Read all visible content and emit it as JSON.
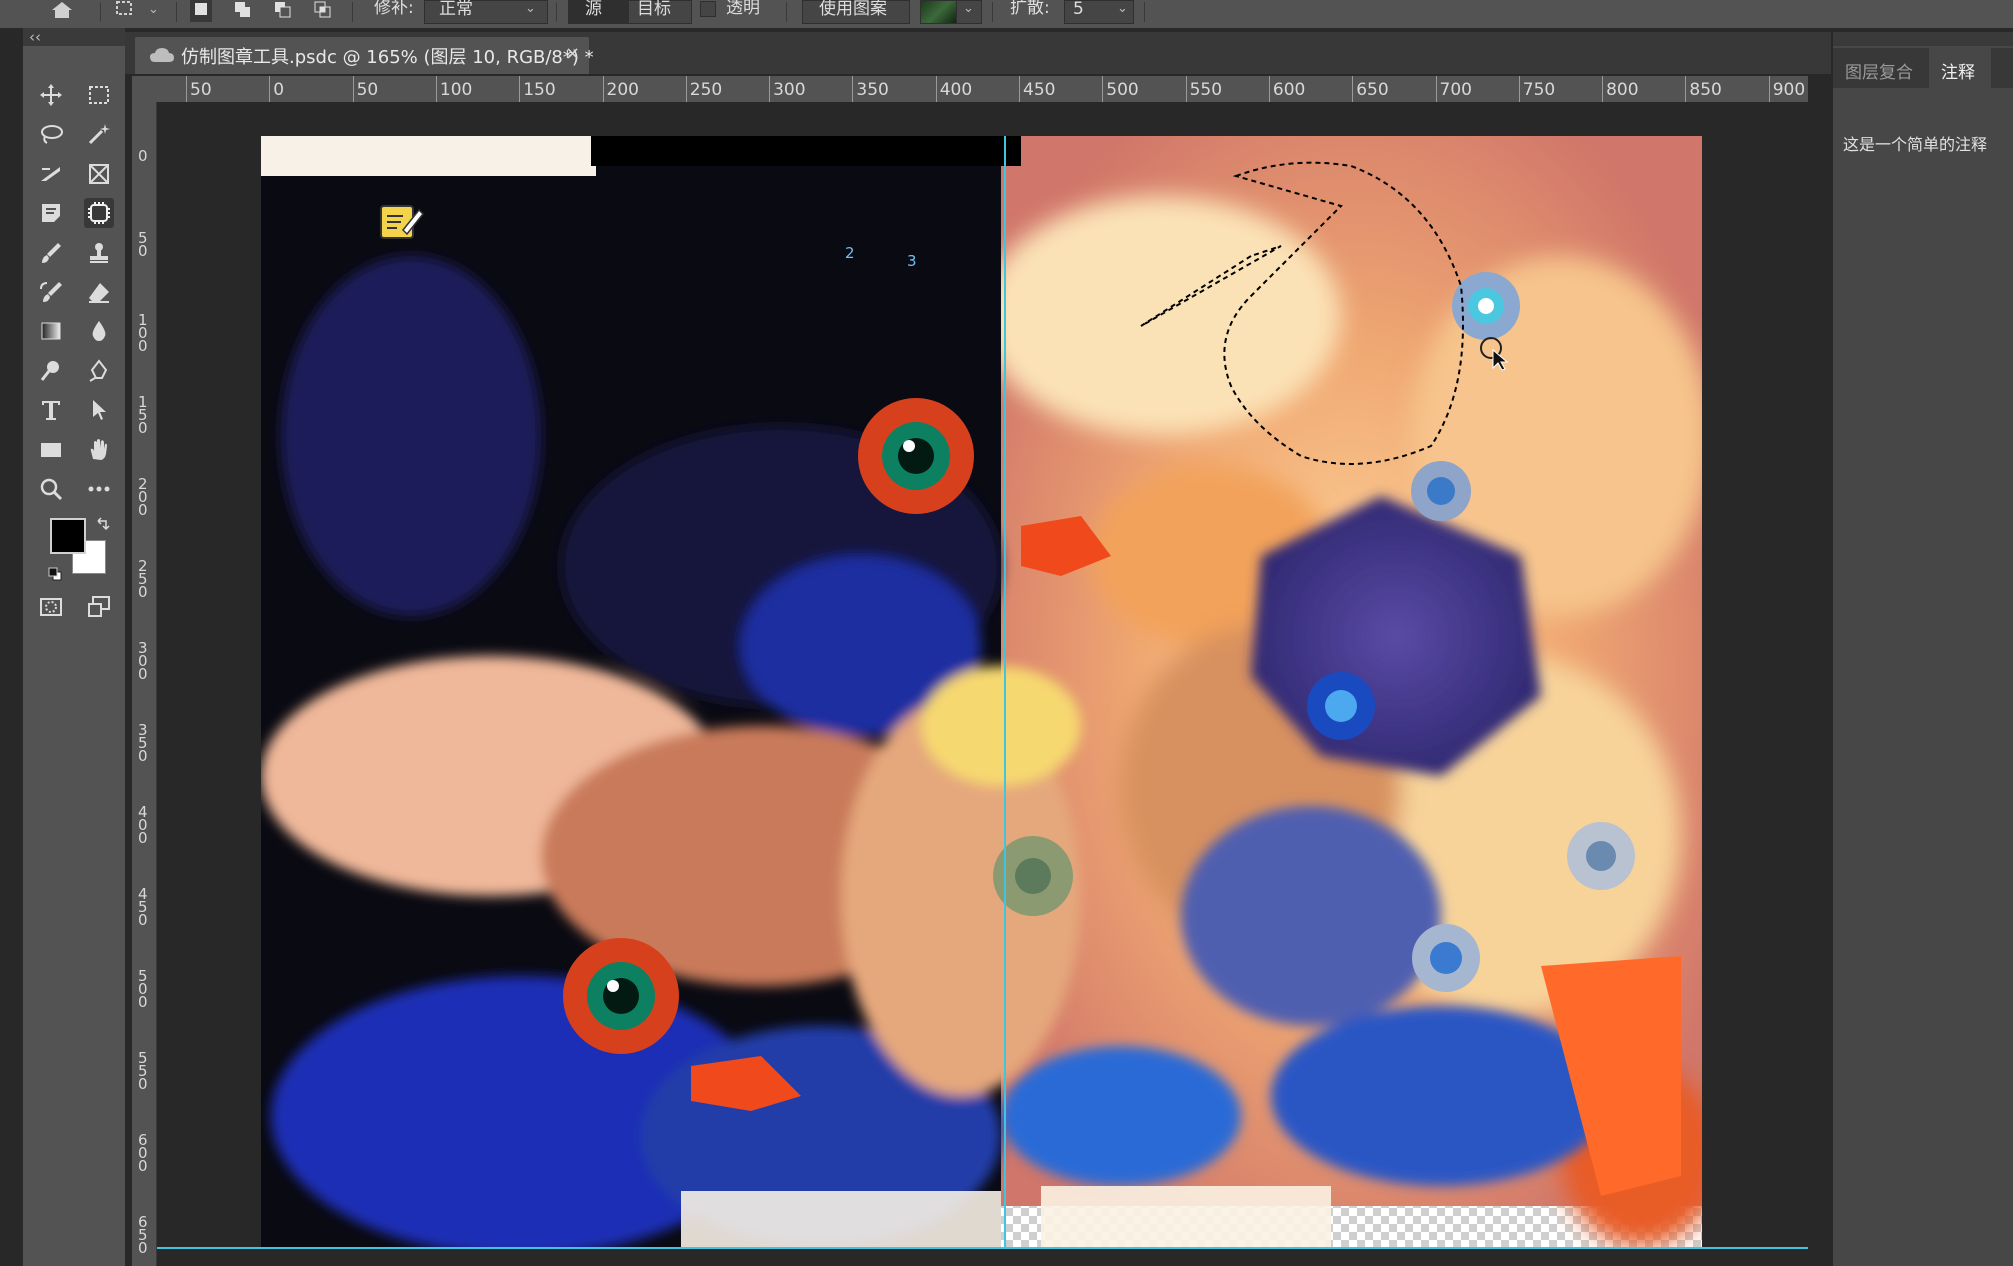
{
  "options_bar": {
    "mode_label": "修补:",
    "mode_value": "正常",
    "source_button": "源",
    "target_button": "目标",
    "transparent_label": "透明",
    "use_pattern_button": "使用图案",
    "diffusion_label": "扩散:",
    "diffusion_value": "5"
  },
  "document": {
    "tab_title": "仿制图章工具.psdc @ 165% (图层 10, RGB/8*) *",
    "close": "×"
  },
  "ruler": {
    "h_labels": [
      "50",
      "0",
      "50",
      "100",
      "150",
      "200",
      "250",
      "300",
      "350",
      "400",
      "450",
      "500",
      "550",
      "600",
      "650",
      "700",
      "750",
      "800",
      "850",
      "900"
    ],
    "v_labels": [
      "0",
      "50",
      "100",
      "150",
      "200",
      "250",
      "300",
      "350",
      "400",
      "450",
      "500",
      "550",
      "600",
      "650"
    ]
  },
  "toolbar": {
    "collapse": "‹‹"
  },
  "right_panel": {
    "tabs": [
      "图层复合",
      "注释"
    ],
    "note_text": "这是一个简单的注释"
  },
  "canvas_marks": {
    "mark_2": "2",
    "mark_3": "3"
  },
  "colors": {
    "foreground": "#000000",
    "background": "#ffffff",
    "guide": "#3ec6e0"
  }
}
